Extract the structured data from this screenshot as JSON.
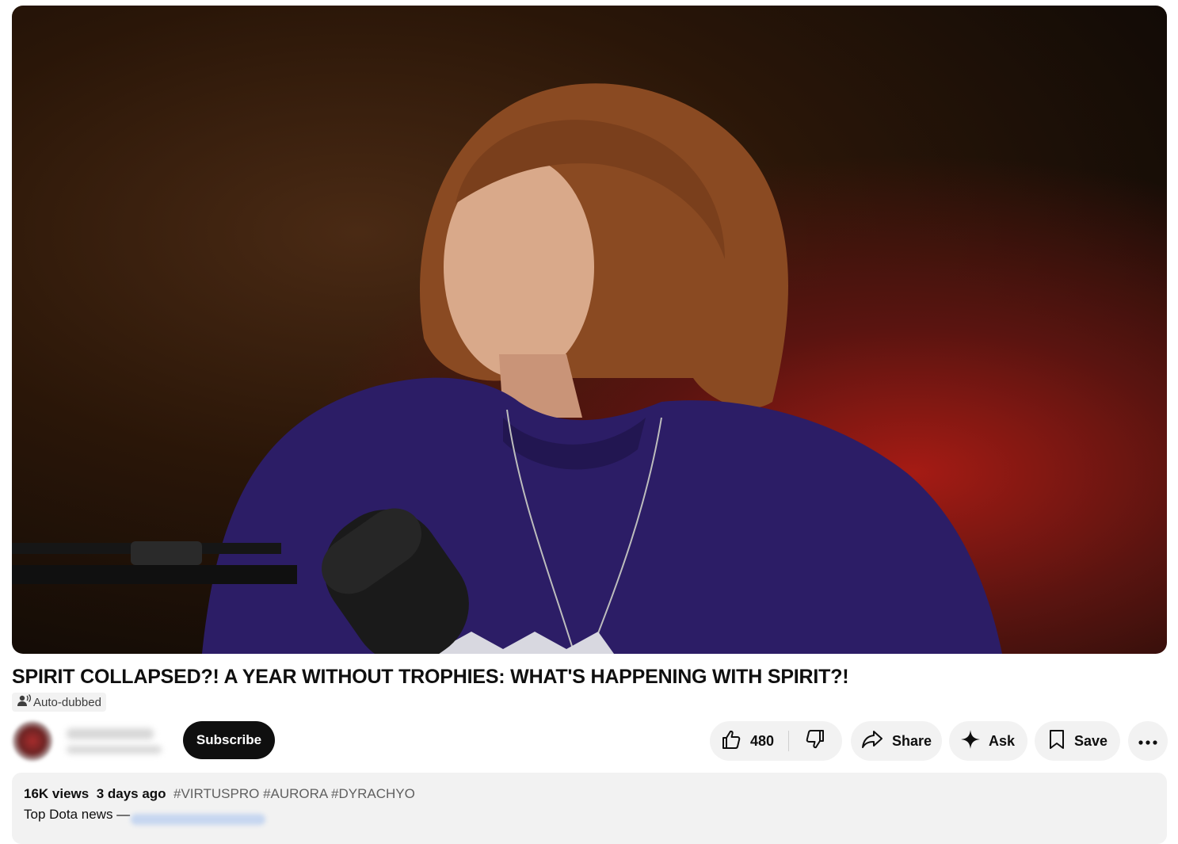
{
  "video": {
    "title": "SPIRIT COLLAPSED?! A YEAR WITHOUT TROPHIES: WHAT'S HAPPENING WITH SPIRIT?!",
    "dub_badge": "Auto-dubbed",
    "dub_icon": "voice-person-icon"
  },
  "channel": {
    "subscribe_label": "Subscribe"
  },
  "actions": {
    "likes": "480",
    "like_icon": "thumbs-up-icon",
    "dislike_icon": "thumbs-down-icon",
    "share_label": "Share",
    "share_icon": "share-arrow-icon",
    "ask_label": "Ask",
    "ask_icon": "sparkle-icon",
    "save_label": "Save",
    "save_icon": "bookmark-icon",
    "more_icon": "more-horizontal-icon"
  },
  "description": {
    "views": "16K views",
    "date": "3 days ago",
    "tags": "#VIRTUSPRO #AURORA #DYRACHYO",
    "line": "Top Dota news —"
  },
  "colors": {
    "subscribe_bg": "#0f0f0f",
    "pill_bg": "#f2f2f2",
    "tag_text": "#606060"
  }
}
